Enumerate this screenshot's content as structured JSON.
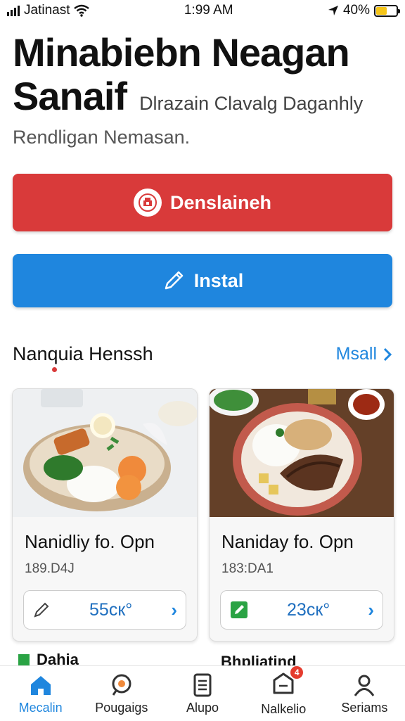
{
  "status": {
    "carrier": "Jatinast",
    "time": "1:99 AM",
    "battery": "40%"
  },
  "header": {
    "title_line1": "Minabiebn Neagan",
    "title_line2": "Sanaif",
    "title_inline_sub": "Dlrazain Clavalg Daganhly",
    "subtitle": "Rendligan Nemasan."
  },
  "actions": {
    "primary_label": "Denslaineh",
    "secondary_label": "Instal"
  },
  "section": {
    "title": "Nanquia Henssh",
    "link": "Msall"
  },
  "cards": [
    {
      "title": "Nanidliy fo. Opn",
      "meta": "189.D4J",
      "price": "55cк°"
    },
    {
      "title": "Naniday fo. Opn",
      "meta": "183:DA1",
      "price": "23cк°"
    }
  ],
  "peek": {
    "item1": "Dahia",
    "item2": "Bhpliatind"
  },
  "tabs": [
    {
      "label": "Mecalin",
      "icon": "home-icon"
    },
    {
      "label": "Pougaigs",
      "icon": "search-icon"
    },
    {
      "label": "Alupo",
      "icon": "list-icon"
    },
    {
      "label": "Nalkelio",
      "icon": "notification-icon",
      "badge": "4"
    },
    {
      "label": "Seriams",
      "icon": "profile-icon"
    }
  ],
  "colors": {
    "red": "#d93a3a",
    "blue": "#1f86de",
    "battery": "#f5c518"
  }
}
